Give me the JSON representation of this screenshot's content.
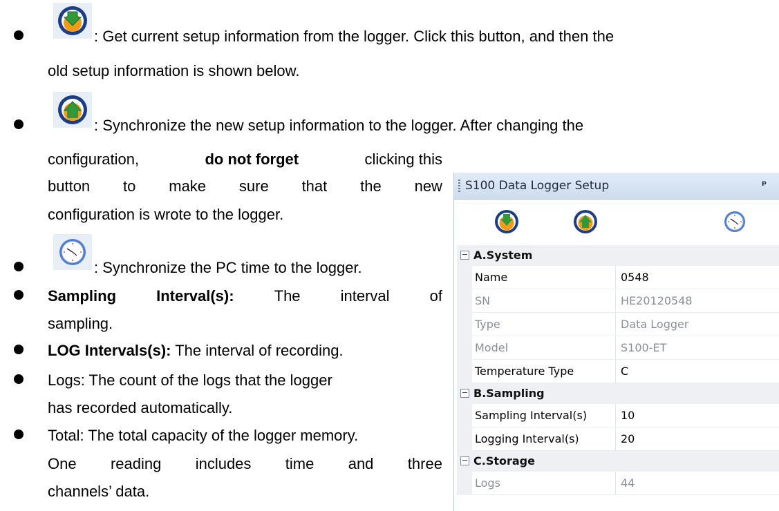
{
  "bullets": {
    "get_setup": {
      "icon": "download-arrow-icon",
      "line1": ": Get current setup information from the logger. Click this button, and then the",
      "line2": "old setup information is shown below."
    },
    "sync_setup": {
      "icon": "upload-arrow-icon",
      "line1": ": Synchronize the new setup information to the logger. After changing the",
      "line2_pre": "configuration,",
      "line2_bold": "do not forget",
      "line2_post": "clicking this",
      "line3": [
        "button",
        "to",
        "make",
        "sure",
        "that",
        "the",
        "new"
      ],
      "line4": "configuration is wrote to the logger."
    },
    "sync_time": {
      "icon": "clock-icon",
      "text": ": Synchronize the PC time to the logger."
    },
    "sampling": {
      "words": [
        "Sampling",
        "Interval(s):",
        "The",
        "interval",
        "of"
      ],
      "line2": "sampling."
    },
    "log_interval": {
      "bold": "LOG Intervals(s):",
      "text": " The interval of recording."
    },
    "logs": {
      "line1": "Logs: The count of the logs that the logger",
      "line2": "has recorded automatically."
    },
    "total": {
      "line1": "Total: The total capacity of the logger memory.",
      "line2": [
        "One",
        "reading",
        "includes",
        "time",
        "and",
        "three"
      ],
      "line3": "channels’ data."
    }
  },
  "panel": {
    "title": "S100 Data Logger Setup",
    "pin": "ᵖ",
    "toolbar": [
      "download-arrow-icon",
      "upload-arrow-icon",
      "clock-icon"
    ],
    "categories": [
      {
        "label": "A.System",
        "toggle": "−",
        "properties": [
          {
            "name": "Name",
            "value": "0548",
            "editable": true
          },
          {
            "name": "SN",
            "value": "HE20120548",
            "editable": false
          },
          {
            "name": "Type",
            "value": "Data Logger",
            "editable": false
          },
          {
            "name": "Model",
            "value": "S100-ET",
            "editable": false
          },
          {
            "name": "Temperature Type",
            "value": "C",
            "editable": true
          }
        ]
      },
      {
        "label": "B.Sampling",
        "toggle": "−",
        "properties": [
          {
            "name": "Sampling Interval(s)",
            "value": "10",
            "editable": true
          },
          {
            "name": "Logging Interval(s)",
            "value": "20",
            "editable": true
          }
        ]
      },
      {
        "label": "C.Storage",
        "toggle": "−",
        "properties": [
          {
            "name": "Logs",
            "value": "44",
            "editable": false
          }
        ]
      }
    ]
  },
  "colors": {
    "orange": "#f39a16",
    "green": "#2e9a3a",
    "navy": "#1d3c86",
    "clock_rim": "#4f7cd1"
  }
}
